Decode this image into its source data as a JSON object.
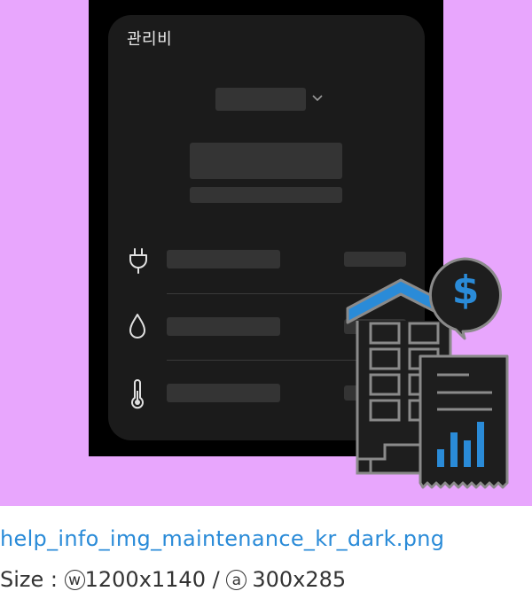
{
  "card": {
    "title": "관리비"
  },
  "rows": [
    {
      "icon": "plug-icon"
    },
    {
      "icon": "water-drop-icon"
    },
    {
      "icon": "thermometer-icon"
    }
  ],
  "illustration": {
    "currency_symbol": "$",
    "icons": [
      "building-icon",
      "bill-receipt-icon",
      "dollar-speech-bubble-icon"
    ]
  },
  "caption": {
    "filename": "help_info_img_maintenance_kr_dark.png",
    "size_label": "Size : ",
    "w_mark": "w",
    "w_size": "1200x1140",
    "sep": " / ",
    "a_mark": "a",
    "a_size": "300x285"
  },
  "colors": {
    "background": "#e8a6fd",
    "card": "#1b1b1b",
    "accent_blue": "#2a8bd8"
  }
}
